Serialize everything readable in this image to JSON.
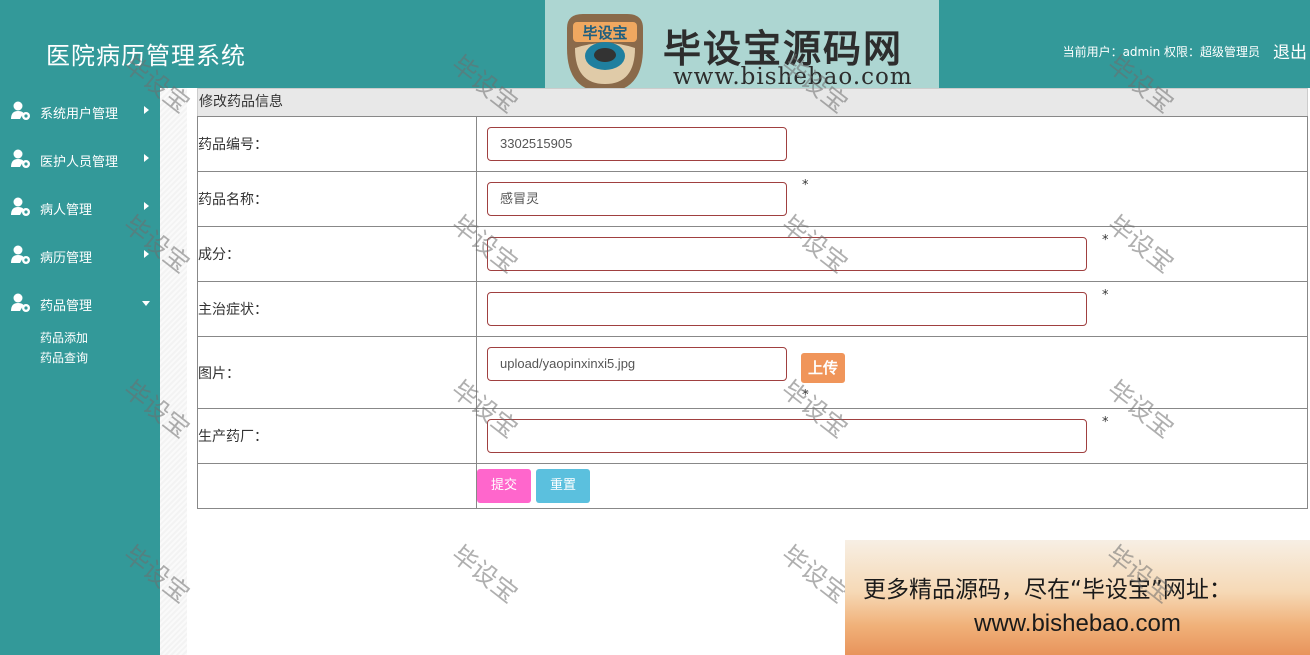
{
  "header": {
    "app_title": "医院病历管理系统",
    "user_info": "当前用户：admin  权限：超级管理员",
    "logout": "退出"
  },
  "logo": {
    "badge_text": "毕设宝",
    "main_text": "毕设宝源码网",
    "url": "www.bishebao.com"
  },
  "sidebar": {
    "items": [
      {
        "label": "系统用户管理",
        "expanded": false
      },
      {
        "label": "医护人员管理",
        "expanded": false
      },
      {
        "label": "病人管理",
        "expanded": false
      },
      {
        "label": "病历管理",
        "expanded": false
      },
      {
        "label": "药品管理",
        "expanded": true
      }
    ],
    "subitems": [
      "药品添加",
      "药品查询"
    ]
  },
  "form": {
    "title": "修改药品信息",
    "fields": {
      "code": {
        "label": "药品编号：",
        "value": "3302515905"
      },
      "name": {
        "label": "药品名称：",
        "value": "感冒灵",
        "required": "*"
      },
      "ingredients": {
        "label": "成分：",
        "value": "",
        "required": "*"
      },
      "symptoms": {
        "label": "主治症状：",
        "value": "",
        "required": "*"
      },
      "image": {
        "label": "图片：",
        "value": "upload/yaopinxinxi5.jpg",
        "upload_label": "上传",
        "required": "*"
      },
      "manufacturer": {
        "label": "生产药厂：",
        "value": "",
        "required": "*"
      }
    },
    "submit_label": "提交",
    "reset_label": "重置"
  },
  "watermark_text": "毕设宝",
  "promo": {
    "line1": "更多精品源码，尽在“毕设宝”网址：",
    "line2": "www.bishebao.com"
  },
  "colors": {
    "primary": "#339999",
    "submit": "#ff66cc",
    "reset": "#5bc0de",
    "upload": "#f0955a",
    "input_border": "#a04040"
  },
  "icons": {
    "nav": "user-gear-icon",
    "collapsed": "caret-right-icon",
    "expanded": "caret-down-icon"
  }
}
